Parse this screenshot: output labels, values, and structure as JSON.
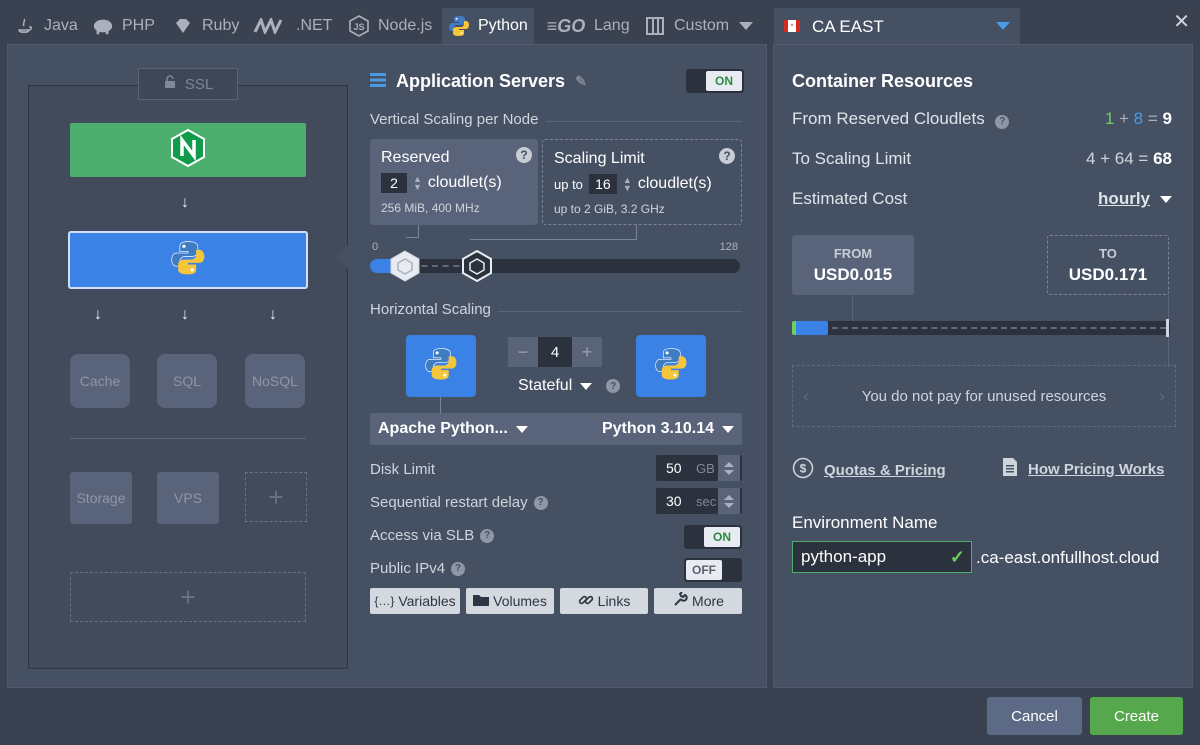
{
  "tabs": [
    {
      "label": "Java",
      "icon": "java-icon"
    },
    {
      "label": "PHP",
      "icon": "php-icon"
    },
    {
      "label": "Ruby",
      "icon": "ruby-icon"
    },
    {
      "label": ".NET",
      "icon": "dotnet-icon"
    },
    {
      "label": "Node.js",
      "icon": "nodejs-icon"
    },
    {
      "label": "Python",
      "icon": "python-icon",
      "active": true
    },
    {
      "label": "Lang",
      "icon": "go-icon",
      "prefix": "GO"
    },
    {
      "label": "Custom",
      "icon": "custom-icon"
    }
  ],
  "region": {
    "label": "CA EAST",
    "flag": "canada-flag-icon"
  },
  "topology": {
    "ssl": "SSL",
    "db": [
      "Cache",
      "SQL",
      "NoSQL"
    ],
    "storage": [
      "Storage",
      "VPS"
    ],
    "plus": "+"
  },
  "app_servers": {
    "title": "Application Servers",
    "toggle": "ON",
    "vertical_label": "Vertical Scaling per Node",
    "reserved": {
      "title": "Reserved",
      "value": "2",
      "unit": "cloudlet(s)",
      "info": "256 MiB, 400 MHz"
    },
    "limit": {
      "title": "Scaling Limit",
      "prefix": "up to",
      "value": "16",
      "unit": "cloudlet(s)",
      "info_prefix": "up to",
      "info": "2 GiB, 3.2 GHz"
    },
    "slider_min": "0",
    "slider_max": "128",
    "horizontal_label": "Horizontal Scaling",
    "node_count": "4",
    "minus": "−",
    "plus": "+",
    "mode": "Stateful",
    "stack": "Apache Python...",
    "version": "Python 3.10.14",
    "disk_label": "Disk Limit",
    "disk_value": "50",
    "disk_unit": "GB",
    "restart_label": "Sequential restart delay",
    "restart_value": "30",
    "restart_unit": "sec",
    "slb_label": "Access via SLB",
    "slb_toggle": "ON",
    "ipv4_label": "Public IPv4",
    "ipv4_toggle": "OFF",
    "buttons": [
      "Variables",
      "Volumes",
      "Links",
      "More"
    ]
  },
  "resources": {
    "title": "Container Resources",
    "reserved_label": "From Reserved Cloudlets",
    "reserved_a": "1",
    "reserved_b": "8",
    "reserved_total": "9",
    "limit_label": "To Scaling Limit",
    "limit_expr": "4 + 64 =",
    "limit_total": "68",
    "cost_label": "Estimated Cost",
    "cost_period": "hourly",
    "from_label": "FROM",
    "from_value": "USD0.015",
    "to_label": "TO",
    "to_value": "USD0.171",
    "banner": "You do not pay for unused resources",
    "quotas": "Quotas & Pricing",
    "how": "How Pricing Works",
    "env_label": "Environment Name",
    "env_value": "python-app",
    "env_domain": ".ca-east.onfullhost.cloud"
  },
  "footer": {
    "cancel": "Cancel",
    "create": "Create"
  },
  "colors": {
    "accent": "#3b82e6",
    "success": "#4caf6e",
    "panel": "#465063"
  }
}
